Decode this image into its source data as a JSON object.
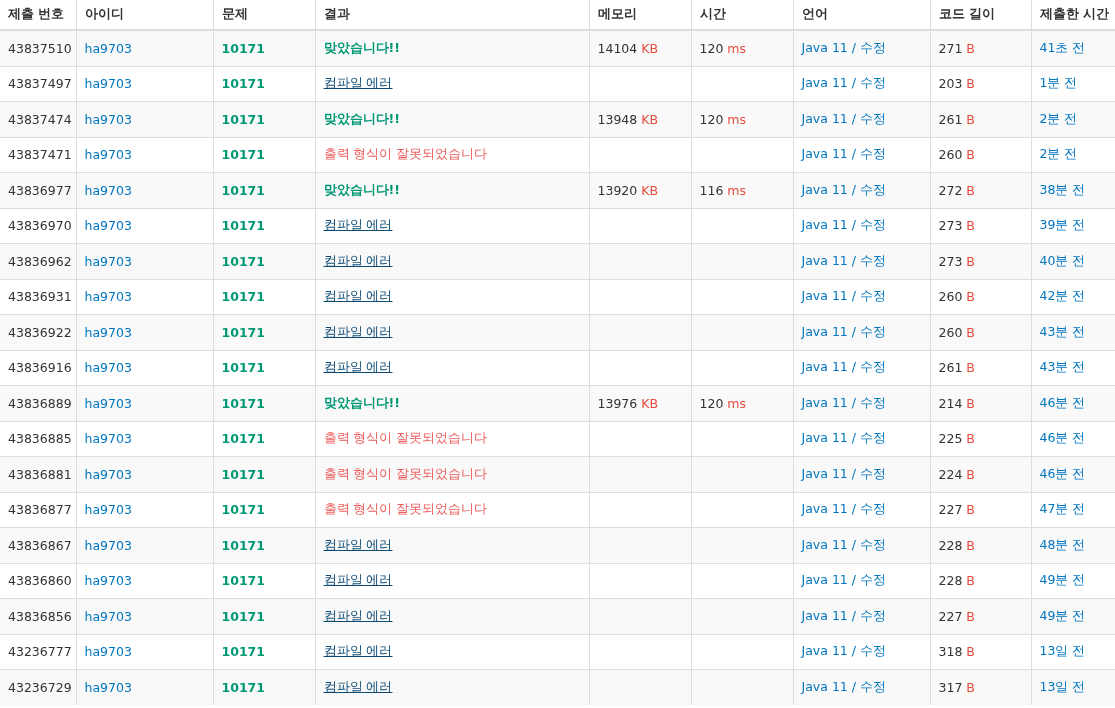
{
  "columns": [
    "제출 번호",
    "아이디",
    "문제",
    "결과",
    "메모리",
    "시간",
    "언어",
    "코드 길이",
    "제출한 시간"
  ],
  "rows": [
    {
      "id": "43837510",
      "user": "ha9703",
      "problem": "10171",
      "result": {
        "kind": "ac",
        "text": "맞았습니다!!"
      },
      "memory": {
        "value": "14104",
        "unit": "KB"
      },
      "time": {
        "value": "120",
        "unit": "ms"
      },
      "language": "Java 11",
      "separator": "/",
      "edit": "수정",
      "length": {
        "value": "271",
        "unit": "B"
      },
      "submitted": "41초 전"
    },
    {
      "id": "43837497",
      "user": "ha9703",
      "problem": "10171",
      "result": {
        "kind": "ce",
        "text": "컴파일 에러"
      },
      "language": "Java 11",
      "separator": "/",
      "edit": "수정",
      "length": {
        "value": "203",
        "unit": "B"
      },
      "submitted": "1분 전"
    },
    {
      "id": "43837474",
      "user": "ha9703",
      "problem": "10171",
      "result": {
        "kind": "ac",
        "text": "맞았습니다!!"
      },
      "memory": {
        "value": "13948",
        "unit": "KB"
      },
      "time": {
        "value": "120",
        "unit": "ms"
      },
      "language": "Java 11",
      "separator": "/",
      "edit": "수정",
      "length": {
        "value": "261",
        "unit": "B"
      },
      "submitted": "2분 전"
    },
    {
      "id": "43837471",
      "user": "ha9703",
      "problem": "10171",
      "result": {
        "kind": "pe",
        "text": "출력 형식이 잘못되었습니다"
      },
      "language": "Java 11",
      "separator": "/",
      "edit": "수정",
      "length": {
        "value": "260",
        "unit": "B"
      },
      "submitted": "2분 전"
    },
    {
      "id": "43836977",
      "user": "ha9703",
      "problem": "10171",
      "result": {
        "kind": "ac",
        "text": "맞았습니다!!"
      },
      "memory": {
        "value": "13920",
        "unit": "KB"
      },
      "time": {
        "value": "116",
        "unit": "ms"
      },
      "language": "Java 11",
      "separator": "/",
      "edit": "수정",
      "length": {
        "value": "272",
        "unit": "B"
      },
      "submitted": "38분 전"
    },
    {
      "id": "43836970",
      "user": "ha9703",
      "problem": "10171",
      "result": {
        "kind": "ce",
        "text": "컴파일 에러"
      },
      "language": "Java 11",
      "separator": "/",
      "edit": "수정",
      "length": {
        "value": "273",
        "unit": "B"
      },
      "submitted": "39분 전"
    },
    {
      "id": "43836962",
      "user": "ha9703",
      "problem": "10171",
      "result": {
        "kind": "ce",
        "text": "컴파일 에러"
      },
      "language": "Java 11",
      "separator": "/",
      "edit": "수정",
      "length": {
        "value": "273",
        "unit": "B"
      },
      "submitted": "40분 전"
    },
    {
      "id": "43836931",
      "user": "ha9703",
      "problem": "10171",
      "result": {
        "kind": "ce",
        "text": "컴파일 에러"
      },
      "language": "Java 11",
      "separator": "/",
      "edit": "수정",
      "length": {
        "value": "260",
        "unit": "B"
      },
      "submitted": "42분 전"
    },
    {
      "id": "43836922",
      "user": "ha9703",
      "problem": "10171",
      "result": {
        "kind": "ce",
        "text": "컴파일 에러"
      },
      "language": "Java 11",
      "separator": "/",
      "edit": "수정",
      "length": {
        "value": "260",
        "unit": "B"
      },
      "submitted": "43분 전"
    },
    {
      "id": "43836916",
      "user": "ha9703",
      "problem": "10171",
      "result": {
        "kind": "ce",
        "text": "컴파일 에러"
      },
      "language": "Java 11",
      "separator": "/",
      "edit": "수정",
      "length": {
        "value": "261",
        "unit": "B"
      },
      "submitted": "43분 전"
    },
    {
      "id": "43836889",
      "user": "ha9703",
      "problem": "10171",
      "result": {
        "kind": "ac",
        "text": "맞았습니다!!"
      },
      "memory": {
        "value": "13976",
        "unit": "KB"
      },
      "time": {
        "value": "120",
        "unit": "ms"
      },
      "language": "Java 11",
      "separator": "/",
      "edit": "수정",
      "length": {
        "value": "214",
        "unit": "B"
      },
      "submitted": "46분 전"
    },
    {
      "id": "43836885",
      "user": "ha9703",
      "problem": "10171",
      "result": {
        "kind": "pe",
        "text": "출력 형식이 잘못되었습니다"
      },
      "language": "Java 11",
      "separator": "/",
      "edit": "수정",
      "length": {
        "value": "225",
        "unit": "B"
      },
      "submitted": "46분 전"
    },
    {
      "id": "43836881",
      "user": "ha9703",
      "problem": "10171",
      "result": {
        "kind": "pe",
        "text": "출력 형식이 잘못되었습니다"
      },
      "language": "Java 11",
      "separator": "/",
      "edit": "수정",
      "length": {
        "value": "224",
        "unit": "B"
      },
      "submitted": "46분 전"
    },
    {
      "id": "43836877",
      "user": "ha9703",
      "problem": "10171",
      "result": {
        "kind": "pe",
        "text": "출력 형식이 잘못되었습니다"
      },
      "language": "Java 11",
      "separator": "/",
      "edit": "수정",
      "length": {
        "value": "227",
        "unit": "B"
      },
      "submitted": "47분 전"
    },
    {
      "id": "43836867",
      "user": "ha9703",
      "problem": "10171",
      "result": {
        "kind": "ce",
        "text": "컴파일 에러"
      },
      "language": "Java 11",
      "separator": "/",
      "edit": "수정",
      "length": {
        "value": "228",
        "unit": "B"
      },
      "submitted": "48분 전"
    },
    {
      "id": "43836860",
      "user": "ha9703",
      "problem": "10171",
      "result": {
        "kind": "ce",
        "text": "컴파일 에러"
      },
      "language": "Java 11",
      "separator": "/",
      "edit": "수정",
      "length": {
        "value": "228",
        "unit": "B"
      },
      "submitted": "49분 전"
    },
    {
      "id": "43836856",
      "user": "ha9703",
      "problem": "10171",
      "result": {
        "kind": "ce",
        "text": "컴파일 에러"
      },
      "language": "Java 11",
      "separator": "/",
      "edit": "수정",
      "length": {
        "value": "227",
        "unit": "B"
      },
      "submitted": "49분 전"
    },
    {
      "id": "43236777",
      "user": "ha9703",
      "problem": "10171",
      "result": {
        "kind": "ce",
        "text": "컴파일 에러"
      },
      "language": "Java 11",
      "separator": "/",
      "edit": "수정",
      "length": {
        "value": "318",
        "unit": "B"
      },
      "submitted": "13일 전"
    },
    {
      "id": "43236729",
      "user": "ha9703",
      "problem": "10171",
      "result": {
        "kind": "ce",
        "text": "컴파일 에러"
      },
      "language": "Java 11",
      "separator": "/",
      "edit": "수정",
      "length": {
        "value": "317",
        "unit": "B"
      },
      "submitted": "13일 전"
    }
  ]
}
